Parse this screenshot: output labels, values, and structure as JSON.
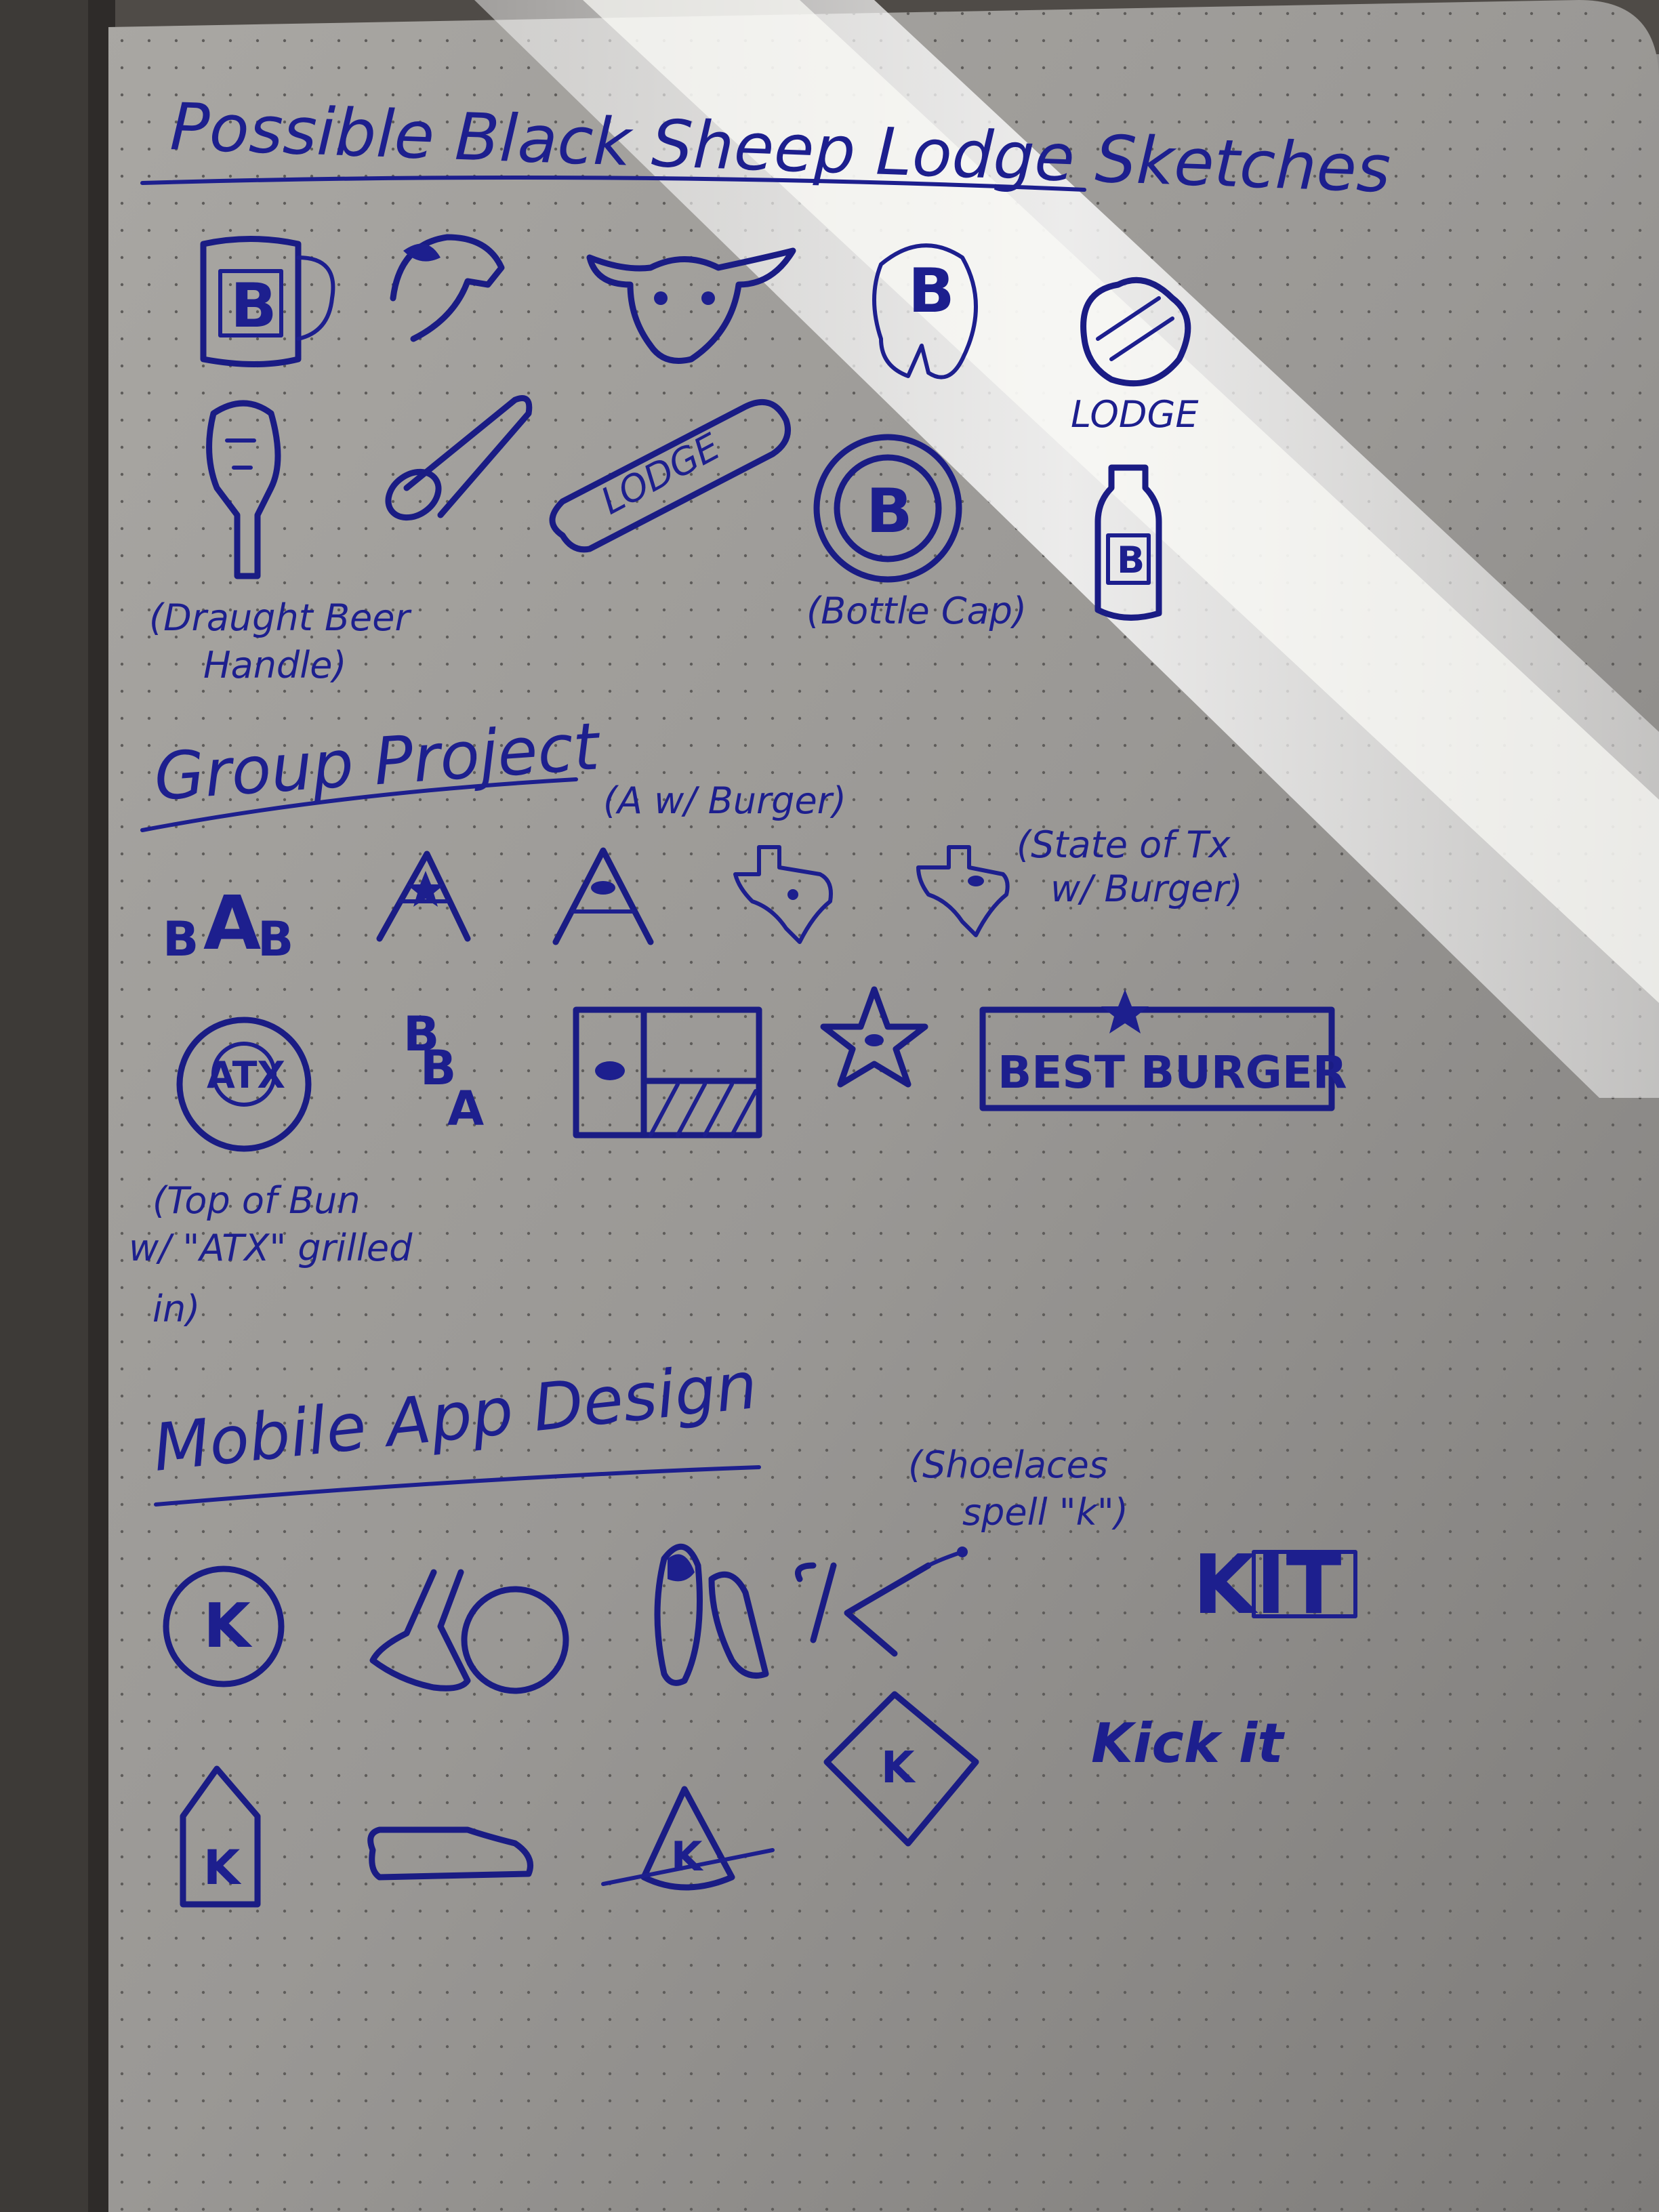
{
  "notebook": {
    "colors": {
      "ink": "#1d1f8e",
      "paper": "#8e8c8a",
      "shadow": "#4f4b47",
      "sunlight": "#f4f3ee"
    }
  },
  "sections": {
    "black_sheep": {
      "heading": "Possible Black Sheep Lodge Sketches",
      "mug_letter": "B",
      "bear_letter": "B",
      "lodge_label": "LODGE",
      "bottle_opener_label": "LODGE",
      "bottle_cap_letter": "B",
      "bottle_letter": "B",
      "tap_handle_caption": [
        "(Draught Beer",
        "Handle)"
      ],
      "bottle_cap_caption": "(Bottle Cap)"
    },
    "group_project": {
      "heading": "Group Project",
      "a_note": "(A w/ Burger)",
      "bab_text": [
        "B",
        "A",
        "B"
      ],
      "texas_note": [
        "(State of Tx",
        "w/ Burger)"
      ],
      "atx_text": "ATX",
      "bba_text": [
        "B",
        "B",
        "A"
      ],
      "best_burger_text": "BEST BURGER",
      "bun_caption": [
        "(Top of Bun",
        "w/ \"ATX\" grilled",
        "in)"
      ]
    },
    "mobile_app": {
      "heading": "Mobile App Design",
      "k_letter": "K",
      "shoelace_note": [
        "(Shoelaces",
        "spell \"k\")"
      ],
      "kit_text": "KIT",
      "kickit_text": "Kick it"
    }
  }
}
